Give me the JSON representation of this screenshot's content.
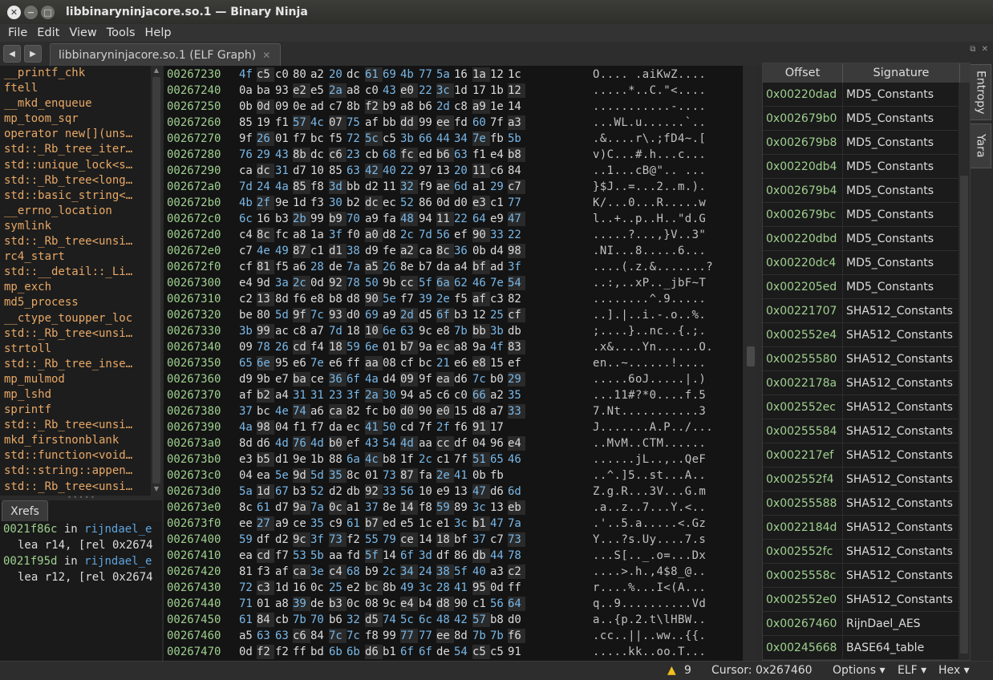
{
  "window": {
    "title": "libbinaryninjacore.so.1 — Binary Ninja"
  },
  "menu": [
    "File",
    "Edit",
    "View",
    "Tools",
    "Help"
  ],
  "tab": {
    "label": "libbinaryninjacore.so.1 (ELF Graph)"
  },
  "functions": [
    "__printf_chk",
    "ftell",
    "__mkd_enqueue",
    "mp_toom_sqr",
    "operator new[](uns…",
    "std::_Rb_tree_iter…",
    "std::unique_lock<s…",
    "std::_Rb_tree<long…",
    "std::basic_string<…",
    "__errno_location",
    "symlink",
    "std::_Rb_tree<unsi…",
    "rc4_start",
    "std::__detail::_Li…",
    "mp_exch",
    "md5_process",
    "__ctype_toupper_loc",
    "std::_Rb_tree<unsi…",
    "strtoll",
    "std::_Rb_tree_inse…",
    "mp_mulmod",
    "mp_lshd",
    "sprintf",
    "std::_Rb_tree<unsi…",
    "mkd_firstnonblank",
    "std::function<void…",
    "std::string::appen…",
    "std::_Rb_tree<unsi…"
  ],
  "xrefs": {
    "tab_label": "Xrefs",
    "items": [
      {
        "addr": "0021f86c",
        "in": "in",
        "func": "rijndael_e",
        "op": "lea r14, [rel 0x2674"
      },
      {
        "addr": "0021f95d",
        "in": "in",
        "func": "rijndael_e",
        "op": "lea r12, [rel 0x2674"
      }
    ]
  },
  "hex": {
    "rows": [
      {
        "addr": "00267230",
        "bytes": "4f c5 c0 80 a2 20 dc 61 69 4b 77 5a 16 1a 12 1c",
        "ascii": "O.... .aiKwZ...."
      },
      {
        "addr": "00267240",
        "bytes": "0a ba 93 e2 e5 2a a8 c0 43 e0 22 3c 1d 17 1b 12",
        "ascii": ".....*..C.\"<...."
      },
      {
        "addr": "00267250",
        "bytes": "0b 0d 09 0e ad c7 8b f2 b9 a8 b6 2d c8 a9 1e 14",
        "ascii": "...........-...."
      },
      {
        "addr": "00267260",
        "bytes": "85 19 f1 57 4c 07 75 af bb dd 99 ee fd 60 7f a3",
        "ascii": "...WL.u......`.."
      },
      {
        "addr": "00267270",
        "bytes": "9f 26 01 f7 bc f5 72 5c c5 3b 66 44 34 7e fb 5b",
        "ascii": ".&....r\\.;fD4~.["
      },
      {
        "addr": "00267280",
        "bytes": "76 29 43 8b dc c6 23 cb 68 fc ed b6 63 f1 e4 b8",
        "ascii": "v)C...#.h...c..."
      },
      {
        "addr": "00267290",
        "bytes": "ca dc 31 d7 10 85 63 42 40 22 97 13 20 11 c6 84",
        "ascii": "..1...cB@\".. ..."
      },
      {
        "addr": "002672a0",
        "bytes": "7d 24 4a 85 f8 3d bb d2 11 32 f9 ae 6d a1 29 c7",
        "ascii": "}$J..=...2..m.)."
      },
      {
        "addr": "002672b0",
        "bytes": "4b 2f 9e 1d f3 30 b2 dc ec 52 86 0d d0 e3 c1 77",
        "ascii": "K/...0...R.....w"
      },
      {
        "addr": "002672c0",
        "bytes": "6c 16 b3 2b 99 b9 70 a9 fa 48 94 11 22 64 e9 47",
        "ascii": "l..+..p..H..\"d.G"
      },
      {
        "addr": "002672d0",
        "bytes": "c4 8c fc a8 1a 3f f0 a0 d8 2c 7d 56 ef 90 33 22",
        "ascii": ".....?...,}V..3\""
      },
      {
        "addr": "002672e0",
        "bytes": "c7 4e 49 87 c1 d1 38 d9 fe a2 ca 8c 36 0b d4 98",
        "ascii": ".NI...8.....6..."
      },
      {
        "addr": "002672f0",
        "bytes": "cf 81 f5 a6 28 de 7a a5 26 8e b7 da a4 bf ad 3f",
        "ascii": "....(.z.&.......?"
      },
      {
        "addr": "00267300",
        "bytes": "e4 9d 3a 2c 0d 92 78 50 9b cc 5f 6a 62 46 7e 54",
        "ascii": "..:,..xP.._jbF~T"
      },
      {
        "addr": "00267310",
        "bytes": "c2 13 8d f6 e8 b8 d8 90 5e f7 39 2e f5 af c3 82",
        "ascii": "........^.9....."
      },
      {
        "addr": "00267320",
        "bytes": "be 80 5d 9f 7c 93 d0 69 a9 2d d5 6f b3 12 25 cf",
        "ascii": "..].|..i.-.o..%."
      },
      {
        "addr": "00267330",
        "bytes": "3b 99 ac c8 a7 7d 18 10 6e 63 9c e8 7b bb 3b db",
        "ascii": ";....}..nc..{.;."
      },
      {
        "addr": "00267340",
        "bytes": "09 78 26 cd f4 18 59 6e 01 b7 9a ec a8 9a 4f 83",
        "ascii": ".x&....Yn......O."
      },
      {
        "addr": "00267350",
        "bytes": "65 6e 95 e6 7e e6 ff aa 08 cf bc 21 e6 e8 15 ef",
        "ascii": "en..~......!...."
      },
      {
        "addr": "00267360",
        "bytes": "d9 9b e7 ba ce 36 6f 4a d4 09 9f ea d6 7c b0 29",
        "ascii": ".....6oJ.....|.)"
      },
      {
        "addr": "00267370",
        "bytes": "af b2 a4 31 31 23 3f 2a 30 94 a5 c6 c0 66 a2 35",
        "ascii": "...11#?*0....f.5"
      },
      {
        "addr": "00267380",
        "bytes": "37 bc 4e 74 a6 ca 82 fc b0 d0 90 e0 15 d8 a7 33",
        "ascii": "7.Nt...........3"
      },
      {
        "addr": "00267390",
        "bytes": "4a 98 04 f1 f7 da ec 41 50 cd 7f 2f f6 91 17",
        "ascii": "J.......A.P../..."
      },
      {
        "addr": "002673a0",
        "bytes": "8d d6 4d 76 4d b0 ef 43 54 4d aa cc df 04 96 e4",
        "ascii": "..MvM..CTM......"
      },
      {
        "addr": "002673b0",
        "bytes": "e3 b5 d1 9e 1b 88 6a 4c b8 1f 2c c1 7f 51 65 46",
        "ascii": "......jL..,..QeF"
      },
      {
        "addr": "002673c0",
        "bytes": "04 ea 5e 9d 5d 35 8c 01 73 87 fa 2e 41 0b fb",
        "ascii": "..^.]5..st...A.."
      },
      {
        "addr": "002673d0",
        "bytes": "5a 1d 67 b3 52 d2 db 92 33 56 10 e9 13 47 d6 6d",
        "ascii": "Z.g.R...3V...G.m"
      },
      {
        "addr": "002673e0",
        "bytes": "8c 61 d7 9a 7a 0c a1 37 8e 14 f8 59 89 3c 13 eb",
        "ascii": ".a..z..7...Y.<.."
      },
      {
        "addr": "002673f0",
        "bytes": "ee 27 a9 ce 35 c9 61 b7 ed e5 1c e1 3c b1 47 7a",
        "ascii": ".'..5.a.....<.Gz"
      },
      {
        "addr": "00267400",
        "bytes": "59 df d2 9c 3f 73 f2 55 79 ce 14 18 bf 37 c7 73",
        "ascii": "Y...?s.Uy....7.s"
      },
      {
        "addr": "00267410",
        "bytes": "ea cd f7 53 5b aa fd 5f 14 6f 3d df 86 db 44 78",
        "ascii": "...S[.._.o=...Dx"
      },
      {
        "addr": "00267420",
        "bytes": "81 f3 af ca 3e c4 68 b9 2c 34 24 38 5f 40 a3 c2",
        "ascii": "....>.h.,4$8_@.."
      },
      {
        "addr": "00267430",
        "bytes": "72 c3 1d 16 0c 25 e2 bc 8b 49 3c 28 41 95 0d ff",
        "ascii": "r....%...I<(A..."
      },
      {
        "addr": "00267440",
        "bytes": "71 01 a8 39 de b3 0c 08 9c e4 b4 d8 90 c1 56 64",
        "ascii": "q..9..........Vd"
      },
      {
        "addr": "00267450",
        "bytes": "61 84 cb 7b 70 b6 32 d5 74 5c 6c 48 42 57 b8 d0",
        "ascii": "a..{p.2.t\\lHBW.."
      },
      {
        "addr": "00267460",
        "bytes": "a5 63 63 c6 84 7c 7c f8 99 77 77 ee 8d 7b 7b f6",
        "ascii": ".cc..||..ww..{{."
      },
      {
        "addr": "00267470",
        "bytes": "0d f2 f2 ff bd 6b 6b d6 b1 6f 6f de 54 c5 c5 91",
        "ascii": ".....kk..oo.T..."
      }
    ]
  },
  "signatures": {
    "headers": [
      "Offset",
      "Signature"
    ],
    "rows": [
      {
        "offset": "0x00220dad",
        "sig": "MD5_Constants"
      },
      {
        "offset": "0x002679b0",
        "sig": "MD5_Constants"
      },
      {
        "offset": "0x002679b8",
        "sig": "MD5_Constants"
      },
      {
        "offset": "0x00220db4",
        "sig": "MD5_Constants"
      },
      {
        "offset": "0x002679b4",
        "sig": "MD5_Constants"
      },
      {
        "offset": "0x002679bc",
        "sig": "MD5_Constants"
      },
      {
        "offset": "0x00220dbd",
        "sig": "MD5_Constants"
      },
      {
        "offset": "0x00220dc4",
        "sig": "MD5_Constants"
      },
      {
        "offset": "0x002205ed",
        "sig": "MD5_Constants"
      },
      {
        "offset": "0x00221707",
        "sig": "SHA512_Constants"
      },
      {
        "offset": "0x002552e4",
        "sig": "SHA512_Constants"
      },
      {
        "offset": "0x00255580",
        "sig": "SHA512_Constants"
      },
      {
        "offset": "0x0022178a",
        "sig": "SHA512_Constants"
      },
      {
        "offset": "0x002552ec",
        "sig": "SHA512_Constants"
      },
      {
        "offset": "0x00255584",
        "sig": "SHA512_Constants"
      },
      {
        "offset": "0x002217ef",
        "sig": "SHA512_Constants"
      },
      {
        "offset": "0x002552f4",
        "sig": "SHA512_Constants"
      },
      {
        "offset": "0x00255588",
        "sig": "SHA512_Constants"
      },
      {
        "offset": "0x0022184d",
        "sig": "SHA512_Constants"
      },
      {
        "offset": "0x002552fc",
        "sig": "SHA512_Constants"
      },
      {
        "offset": "0x0025558c",
        "sig": "SHA512_Constants"
      },
      {
        "offset": "0x002552e0",
        "sig": "SHA512_Constants"
      },
      {
        "offset": "0x00267460",
        "sig": "RijnDael_AES"
      },
      {
        "offset": "0x00245668",
        "sig": "BASE64_table"
      }
    ]
  },
  "side_tabs": [
    "Entropy",
    "Yara"
  ],
  "status": {
    "warnings": "9",
    "cursor": "Cursor: 0x267460",
    "options": "Options ▾",
    "format": "ELF ▾",
    "view": "Hex ▾"
  },
  "colors": {
    "address": "#9fd08f",
    "function": "#e8a866",
    "hex_highlight": "#79b8e8",
    "xref_function": "#5ea5e0"
  }
}
